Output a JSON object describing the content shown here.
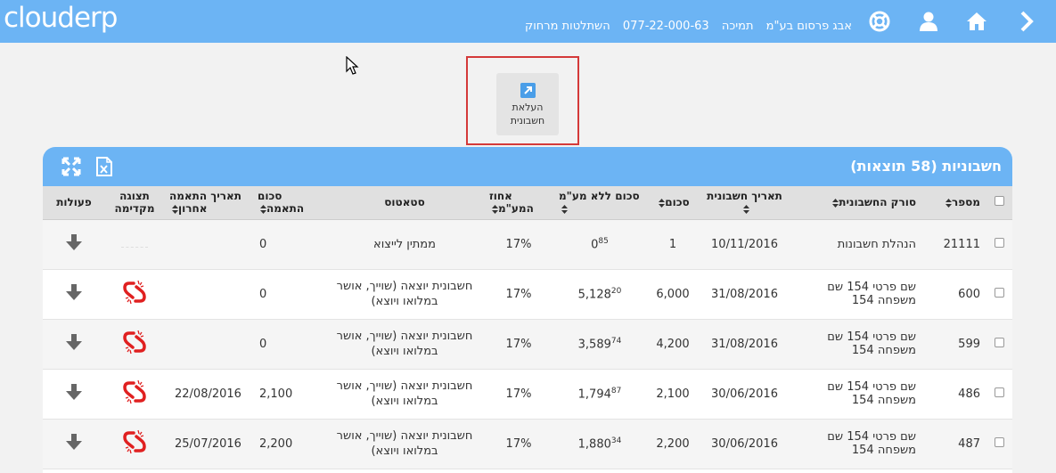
{
  "app": {
    "logo_text": "clouderp",
    "company": "אבג פרסום בע\"מ",
    "support_label": "תמיכה",
    "support_phone": "077-22-000-63",
    "remote_label": "השתלטות מרחוק"
  },
  "upload": {
    "label": "העלאת\nחשבונית"
  },
  "panel": {
    "title": "חשבוניות (58 תוצאות)"
  },
  "table": {
    "headers": {
      "number": "מספר",
      "scanner": "סורק החשבונית",
      "date": "תאריך חשבונית",
      "amount": "סכום",
      "amount_no_vat": "סכום ללא מע\"מ",
      "vat_pct": "אחוז המע\"מ",
      "status": "סטאטוס",
      "match_amount": "סכום התאמה",
      "last_match_date": "תאריך התאמה אחרון",
      "preview": "תצוגה מקדימה",
      "actions": "פעולות"
    },
    "rows": [
      {
        "number": "21111",
        "scanner": "הנהלת חשבונות",
        "date": "10/11/2016",
        "amount": "1",
        "net_int": "0",
        "net_dec": "85",
        "vat": "17%",
        "status": "ממתין לייצוא",
        "match_amount": "0",
        "last_match": "",
        "preview": false
      },
      {
        "number": "600",
        "scanner": "שם פרטי 154 שם משפחה 154",
        "date": "31/08/2016",
        "amount": "6,000",
        "net_int": "5,128",
        "net_dec": "20",
        "vat": "17%",
        "status": "חשבונית יוצאה (שוייך, אושר במלואו ויוצא)",
        "match_amount": "0",
        "last_match": "",
        "preview": true
      },
      {
        "number": "599",
        "scanner": "שם פרטי 154 שם משפחה 154",
        "date": "31/08/2016",
        "amount": "4,200",
        "net_int": "3,589",
        "net_dec": "74",
        "vat": "17%",
        "status": "חשבונית יוצאה (שוייך, אושר במלואו ויוצא)",
        "match_amount": "0",
        "last_match": "",
        "preview": true
      },
      {
        "number": "486",
        "scanner": "שם פרטי 154 שם משפחה 154",
        "date": "30/06/2016",
        "amount": "2,100",
        "net_int": "1,794",
        "net_dec": "87",
        "vat": "17%",
        "status": "חשבונית יוצאה (שוייך, אושר במלואו ויוצא)",
        "match_amount": "2,100",
        "last_match": "22/08/2016",
        "preview": true
      },
      {
        "number": "487",
        "scanner": "שם פרטי 154 שם משפחה 154",
        "date": "30/06/2016",
        "amount": "2,200",
        "net_int": "1,880",
        "net_dec": "34",
        "vat": "17%",
        "status": "חשבונית יוצאה (שוייך, אושר במלואו ויוצא)",
        "match_amount": "2,200",
        "last_match": "25/07/2016",
        "preview": true
      }
    ]
  },
  "icons": {
    "nav_back": "chevron-right-icon",
    "home": "home-icon",
    "user": "user-icon",
    "support": "lifebuoy-icon",
    "expand": "expand-icon",
    "excel": "excel-export-icon",
    "download": "download-arrow-icon",
    "preview": "broken-link-icon"
  },
  "colors": {
    "topbar": "#6cb4f4",
    "highlight": "#d43a3a",
    "preview_icon": "#e02020"
  }
}
